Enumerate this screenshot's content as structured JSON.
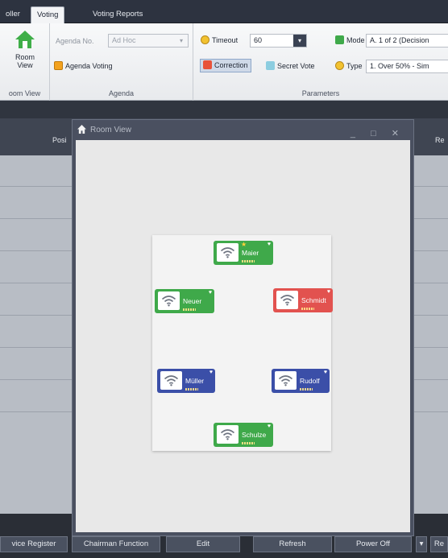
{
  "tabs": [
    "oller",
    "Voting",
    "Voting Reports"
  ],
  "ribbon": {
    "room_view": {
      "label": "Room View",
      "group": "oom View"
    },
    "agenda": {
      "no_label": "Agenda No.",
      "no_value": "Ad Hoc",
      "agenda_voting": "Agenda Voting",
      "group": "Agenda"
    },
    "parameters": {
      "timeout_label": "Timeout",
      "timeout_value": "60",
      "correction": "Correction",
      "secret_vote": "Secret Vote",
      "mode_label": "Mode",
      "mode_value": "A. 1 of 2 (Decision",
      "type_label": "Type",
      "type_value": "1. Over 50% - Sim",
      "group": "Parameters"
    }
  },
  "grid": {
    "col_position": "Posi",
    "col_result": "Re"
  },
  "room_view": {
    "title": "Room View",
    "controls": "_ □ ✕",
    "seats": [
      {
        "name": "Maier",
        "status": "green",
        "star": true
      },
      {
        "name": "Neuer",
        "status": "green",
        "star": false
      },
      {
        "name": "Schmidt",
        "status": "red",
        "star": false
      },
      {
        "name": "Müller",
        "status": "blue",
        "star": false
      },
      {
        "name": "Rudolf",
        "status": "blue",
        "star": false
      },
      {
        "name": "Schulze",
        "status": "green",
        "star": false
      }
    ]
  },
  "bottom_buttons": [
    "vice Register",
    "Chairman Function",
    "Edit",
    "Refresh",
    "Power Off",
    "Re"
  ],
  "colors": {
    "green": "#3fa94a",
    "red": "#e2524f",
    "blue": "#3b4fa8",
    "accent": "#2d3340"
  }
}
